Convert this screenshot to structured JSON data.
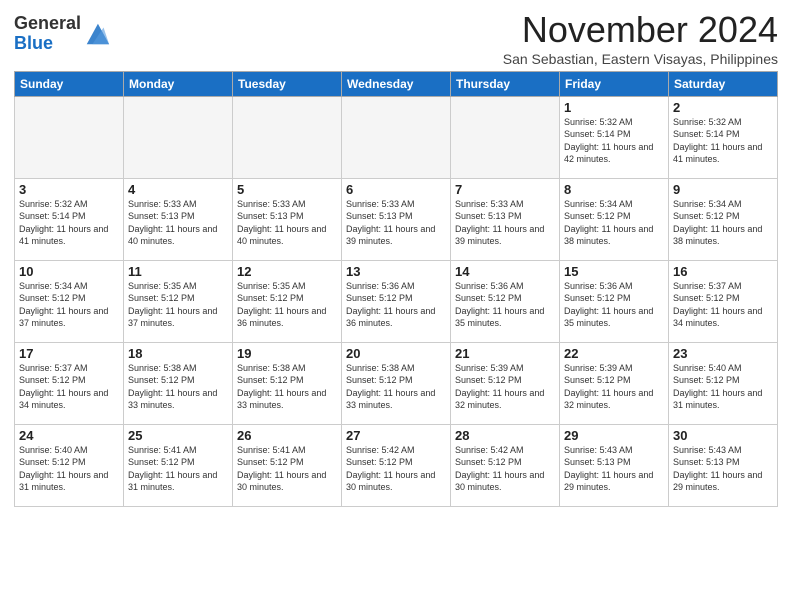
{
  "header": {
    "logo_general": "General",
    "logo_blue": "Blue",
    "month_title": "November 2024",
    "location": "San Sebastian, Eastern Visayas, Philippines"
  },
  "weekdays": [
    "Sunday",
    "Monday",
    "Tuesday",
    "Wednesday",
    "Thursday",
    "Friday",
    "Saturday"
  ],
  "weeks": [
    [
      {
        "day": "",
        "empty": true
      },
      {
        "day": "",
        "empty": true
      },
      {
        "day": "",
        "empty": true
      },
      {
        "day": "",
        "empty": true
      },
      {
        "day": "",
        "empty": true
      },
      {
        "day": "1",
        "sunrise": "5:32 AM",
        "sunset": "5:14 PM",
        "daylight": "11 hours and 42 minutes."
      },
      {
        "day": "2",
        "sunrise": "5:32 AM",
        "sunset": "5:14 PM",
        "daylight": "11 hours and 41 minutes."
      }
    ],
    [
      {
        "day": "3",
        "sunrise": "5:32 AM",
        "sunset": "5:14 PM",
        "daylight": "11 hours and 41 minutes."
      },
      {
        "day": "4",
        "sunrise": "5:33 AM",
        "sunset": "5:13 PM",
        "daylight": "11 hours and 40 minutes."
      },
      {
        "day": "5",
        "sunrise": "5:33 AM",
        "sunset": "5:13 PM",
        "daylight": "11 hours and 40 minutes."
      },
      {
        "day": "6",
        "sunrise": "5:33 AM",
        "sunset": "5:13 PM",
        "daylight": "11 hours and 39 minutes."
      },
      {
        "day": "7",
        "sunrise": "5:33 AM",
        "sunset": "5:13 PM",
        "daylight": "11 hours and 39 minutes."
      },
      {
        "day": "8",
        "sunrise": "5:34 AM",
        "sunset": "5:12 PM",
        "daylight": "11 hours and 38 minutes."
      },
      {
        "day": "9",
        "sunrise": "5:34 AM",
        "sunset": "5:12 PM",
        "daylight": "11 hours and 38 minutes."
      }
    ],
    [
      {
        "day": "10",
        "sunrise": "5:34 AM",
        "sunset": "5:12 PM",
        "daylight": "11 hours and 37 minutes."
      },
      {
        "day": "11",
        "sunrise": "5:35 AM",
        "sunset": "5:12 PM",
        "daylight": "11 hours and 37 minutes."
      },
      {
        "day": "12",
        "sunrise": "5:35 AM",
        "sunset": "5:12 PM",
        "daylight": "11 hours and 36 minutes."
      },
      {
        "day": "13",
        "sunrise": "5:36 AM",
        "sunset": "5:12 PM",
        "daylight": "11 hours and 36 minutes."
      },
      {
        "day": "14",
        "sunrise": "5:36 AM",
        "sunset": "5:12 PM",
        "daylight": "11 hours and 35 minutes."
      },
      {
        "day": "15",
        "sunrise": "5:36 AM",
        "sunset": "5:12 PM",
        "daylight": "11 hours and 35 minutes."
      },
      {
        "day": "16",
        "sunrise": "5:37 AM",
        "sunset": "5:12 PM",
        "daylight": "11 hours and 34 minutes."
      }
    ],
    [
      {
        "day": "17",
        "sunrise": "5:37 AM",
        "sunset": "5:12 PM",
        "daylight": "11 hours and 34 minutes."
      },
      {
        "day": "18",
        "sunrise": "5:38 AM",
        "sunset": "5:12 PM",
        "daylight": "11 hours and 33 minutes."
      },
      {
        "day": "19",
        "sunrise": "5:38 AM",
        "sunset": "5:12 PM",
        "daylight": "11 hours and 33 minutes."
      },
      {
        "day": "20",
        "sunrise": "5:38 AM",
        "sunset": "5:12 PM",
        "daylight": "11 hours and 33 minutes."
      },
      {
        "day": "21",
        "sunrise": "5:39 AM",
        "sunset": "5:12 PM",
        "daylight": "11 hours and 32 minutes."
      },
      {
        "day": "22",
        "sunrise": "5:39 AM",
        "sunset": "5:12 PM",
        "daylight": "11 hours and 32 minutes."
      },
      {
        "day": "23",
        "sunrise": "5:40 AM",
        "sunset": "5:12 PM",
        "daylight": "11 hours and 31 minutes."
      }
    ],
    [
      {
        "day": "24",
        "sunrise": "5:40 AM",
        "sunset": "5:12 PM",
        "daylight": "11 hours and 31 minutes."
      },
      {
        "day": "25",
        "sunrise": "5:41 AM",
        "sunset": "5:12 PM",
        "daylight": "11 hours and 31 minutes."
      },
      {
        "day": "26",
        "sunrise": "5:41 AM",
        "sunset": "5:12 PM",
        "daylight": "11 hours and 30 minutes."
      },
      {
        "day": "27",
        "sunrise": "5:42 AM",
        "sunset": "5:12 PM",
        "daylight": "11 hours and 30 minutes."
      },
      {
        "day": "28",
        "sunrise": "5:42 AM",
        "sunset": "5:12 PM",
        "daylight": "11 hours and 30 minutes."
      },
      {
        "day": "29",
        "sunrise": "5:43 AM",
        "sunset": "5:13 PM",
        "daylight": "11 hours and 29 minutes."
      },
      {
        "day": "30",
        "sunrise": "5:43 AM",
        "sunset": "5:13 PM",
        "daylight": "11 hours and 29 minutes."
      }
    ]
  ]
}
